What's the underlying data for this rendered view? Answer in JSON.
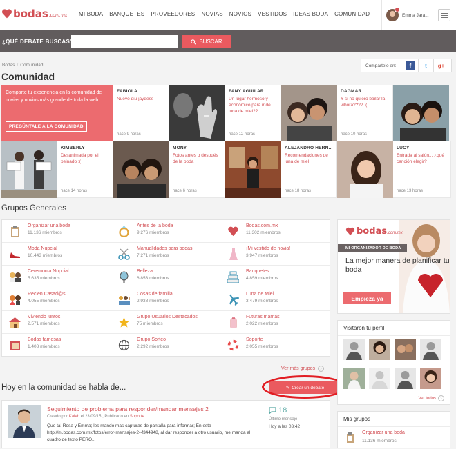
{
  "brand": {
    "name": "bodas",
    "tld": ".com.mx"
  },
  "nav": [
    "MI BODA",
    "BANQUETES",
    "PROVEEDORES",
    "NOVIAS",
    "NOVIOS",
    "VESTIDOS",
    "IDEAS BODA",
    "COMUNIDAD"
  ],
  "user": {
    "name": "Emma Jara..."
  },
  "search": {
    "label": "¿QUÉ DEBATE BUSCAS?",
    "placeholder": "",
    "button": "BUSCAR"
  },
  "breadcrumb": {
    "home": "Bodas",
    "current": "Comunidad"
  },
  "share": {
    "label": "Compártelo en:",
    "networks": [
      "f",
      "t",
      "g+"
    ]
  },
  "page_title": "Comunidad",
  "promo": {
    "text": "Comparte tu experiencia en la comunidad de novias y novios más grande de toda la web",
    "button": "PREGÚNTALE A LA COMUNIDAD"
  },
  "posts": [
    {
      "name": "FABIOLA",
      "text": "Nuevo diu jaydess",
      "time": "hace 9 horas"
    },
    {
      "name": "FANY AGUILAR",
      "text": "Un lugar hermoso y económico para ir de luna de miel??",
      "time": "hace 12 horas"
    },
    {
      "name": "DAGMAR",
      "text": "Y si no quiero bailar la víbora???? :(",
      "time": "hace 10 horas"
    },
    {
      "name": "KIMBERLY",
      "text": "Desanimada por el peinado :(",
      "time": "hace 14 horas"
    },
    {
      "name": "MONY",
      "text": "Fotos antes o después de la boda",
      "time": "hace 6 horas"
    },
    {
      "name": "ALEJANDRO HERN...",
      "text": "Recomendaciones de luna de miel",
      "time": "hace 18 horas"
    },
    {
      "name": "LUCY",
      "text": "Entrada al salón... ¿qué canción elegir?",
      "time": "hace 13 horas"
    }
  ],
  "groups_title": "Grupos Generales",
  "groups": [
    {
      "name": "Organizar una boda",
      "members": "11.136 miembros",
      "icon": "clipboard-icon"
    },
    {
      "name": "Antes de la boda",
      "members": "9.276 miembros",
      "icon": "ring-icon"
    },
    {
      "name": "Bodas.com.mx",
      "members": "11.302 miembros",
      "icon": "heart-icon"
    },
    {
      "name": "Moda Nupcial",
      "members": "10.443 miembros",
      "icon": "shoe-icon"
    },
    {
      "name": "Manualidades para bodas",
      "members": "7.271 miembros",
      "icon": "scissors-icon"
    },
    {
      "name": "¡Mi vestido de novia!",
      "members": "3.947 miembros",
      "icon": "dress-icon"
    },
    {
      "name": "Ceremonia Nupcial",
      "members": "5.635 miembros",
      "icon": "couple-icon"
    },
    {
      "name": "Belleza",
      "members": "6.853 miembros",
      "icon": "mirror-icon"
    },
    {
      "name": "Banquetes",
      "members": "4.859 miembros",
      "icon": "cake-icon"
    },
    {
      "name": "Recién Casad@s",
      "members": "4.055 miembros",
      "icon": "newlyweds-icon"
    },
    {
      "name": "Cosas de familia",
      "members": "2.938 miembros",
      "icon": "family-icon"
    },
    {
      "name": "Luna de Miel",
      "members": "3.479 miembros",
      "icon": "plane-icon"
    },
    {
      "name": "Viviendo juntos",
      "members": "2.571 miembros",
      "icon": "house-icon"
    },
    {
      "name": "Grupo Usuarios Destacados",
      "members": "75 miembros",
      "icon": "star-icon"
    },
    {
      "name": "Futuras mamás",
      "members": "2.022 miembros",
      "icon": "bottle-icon"
    },
    {
      "name": "Bodas famosas",
      "members": "1.408 miembros",
      "icon": "magazine-icon"
    },
    {
      "name": "Grupo Sorteo",
      "members": "2.292 miembros",
      "icon": "globe-icon"
    },
    {
      "name": "Soporte",
      "members": "2.055 miembros",
      "icon": "lifebuoy-icon"
    }
  ],
  "more_groups": "Ver más grupos",
  "hoy_title": "Hoy en la comunidad se habla de...",
  "create_debate": "Crear un debate",
  "debate": {
    "title": "Seguimiento de problema para responder/mandar mensajes 2",
    "meta_prefix": "Creado por",
    "author": "Kaleb",
    "date": "el 23/09/15 , Publicado en",
    "category": "Soporte",
    "text": "Que tal Rosa y Emma; les mando mas capturas de pantalla para informar; En esta http://m.bodas.com.mx/fotos/error-mensajes-2--f344948, al dar responder a otro usuario, me manda al cuadro de texto PERO...",
    "count": "18",
    "last_label": "Último mensaje",
    "last_time": "Hoy a las 03:42"
  },
  "ad": {
    "strip": "MI ORGANIZADOR DE BODA",
    "tagline": "La mejor manera de planificar tu boda",
    "button": "Empieza ya"
  },
  "visits": {
    "title": "Visitaron tu perfil",
    "link": "Ver todos"
  },
  "my_groups": {
    "title": "Mis grupos",
    "name": "Organizar una boda",
    "members": "11.136 miembros"
  },
  "colors": {
    "accent": "#d24f54",
    "button": "#ea5a5f",
    "promo": "#ec6b6f",
    "searchbar": "#615c5d"
  }
}
